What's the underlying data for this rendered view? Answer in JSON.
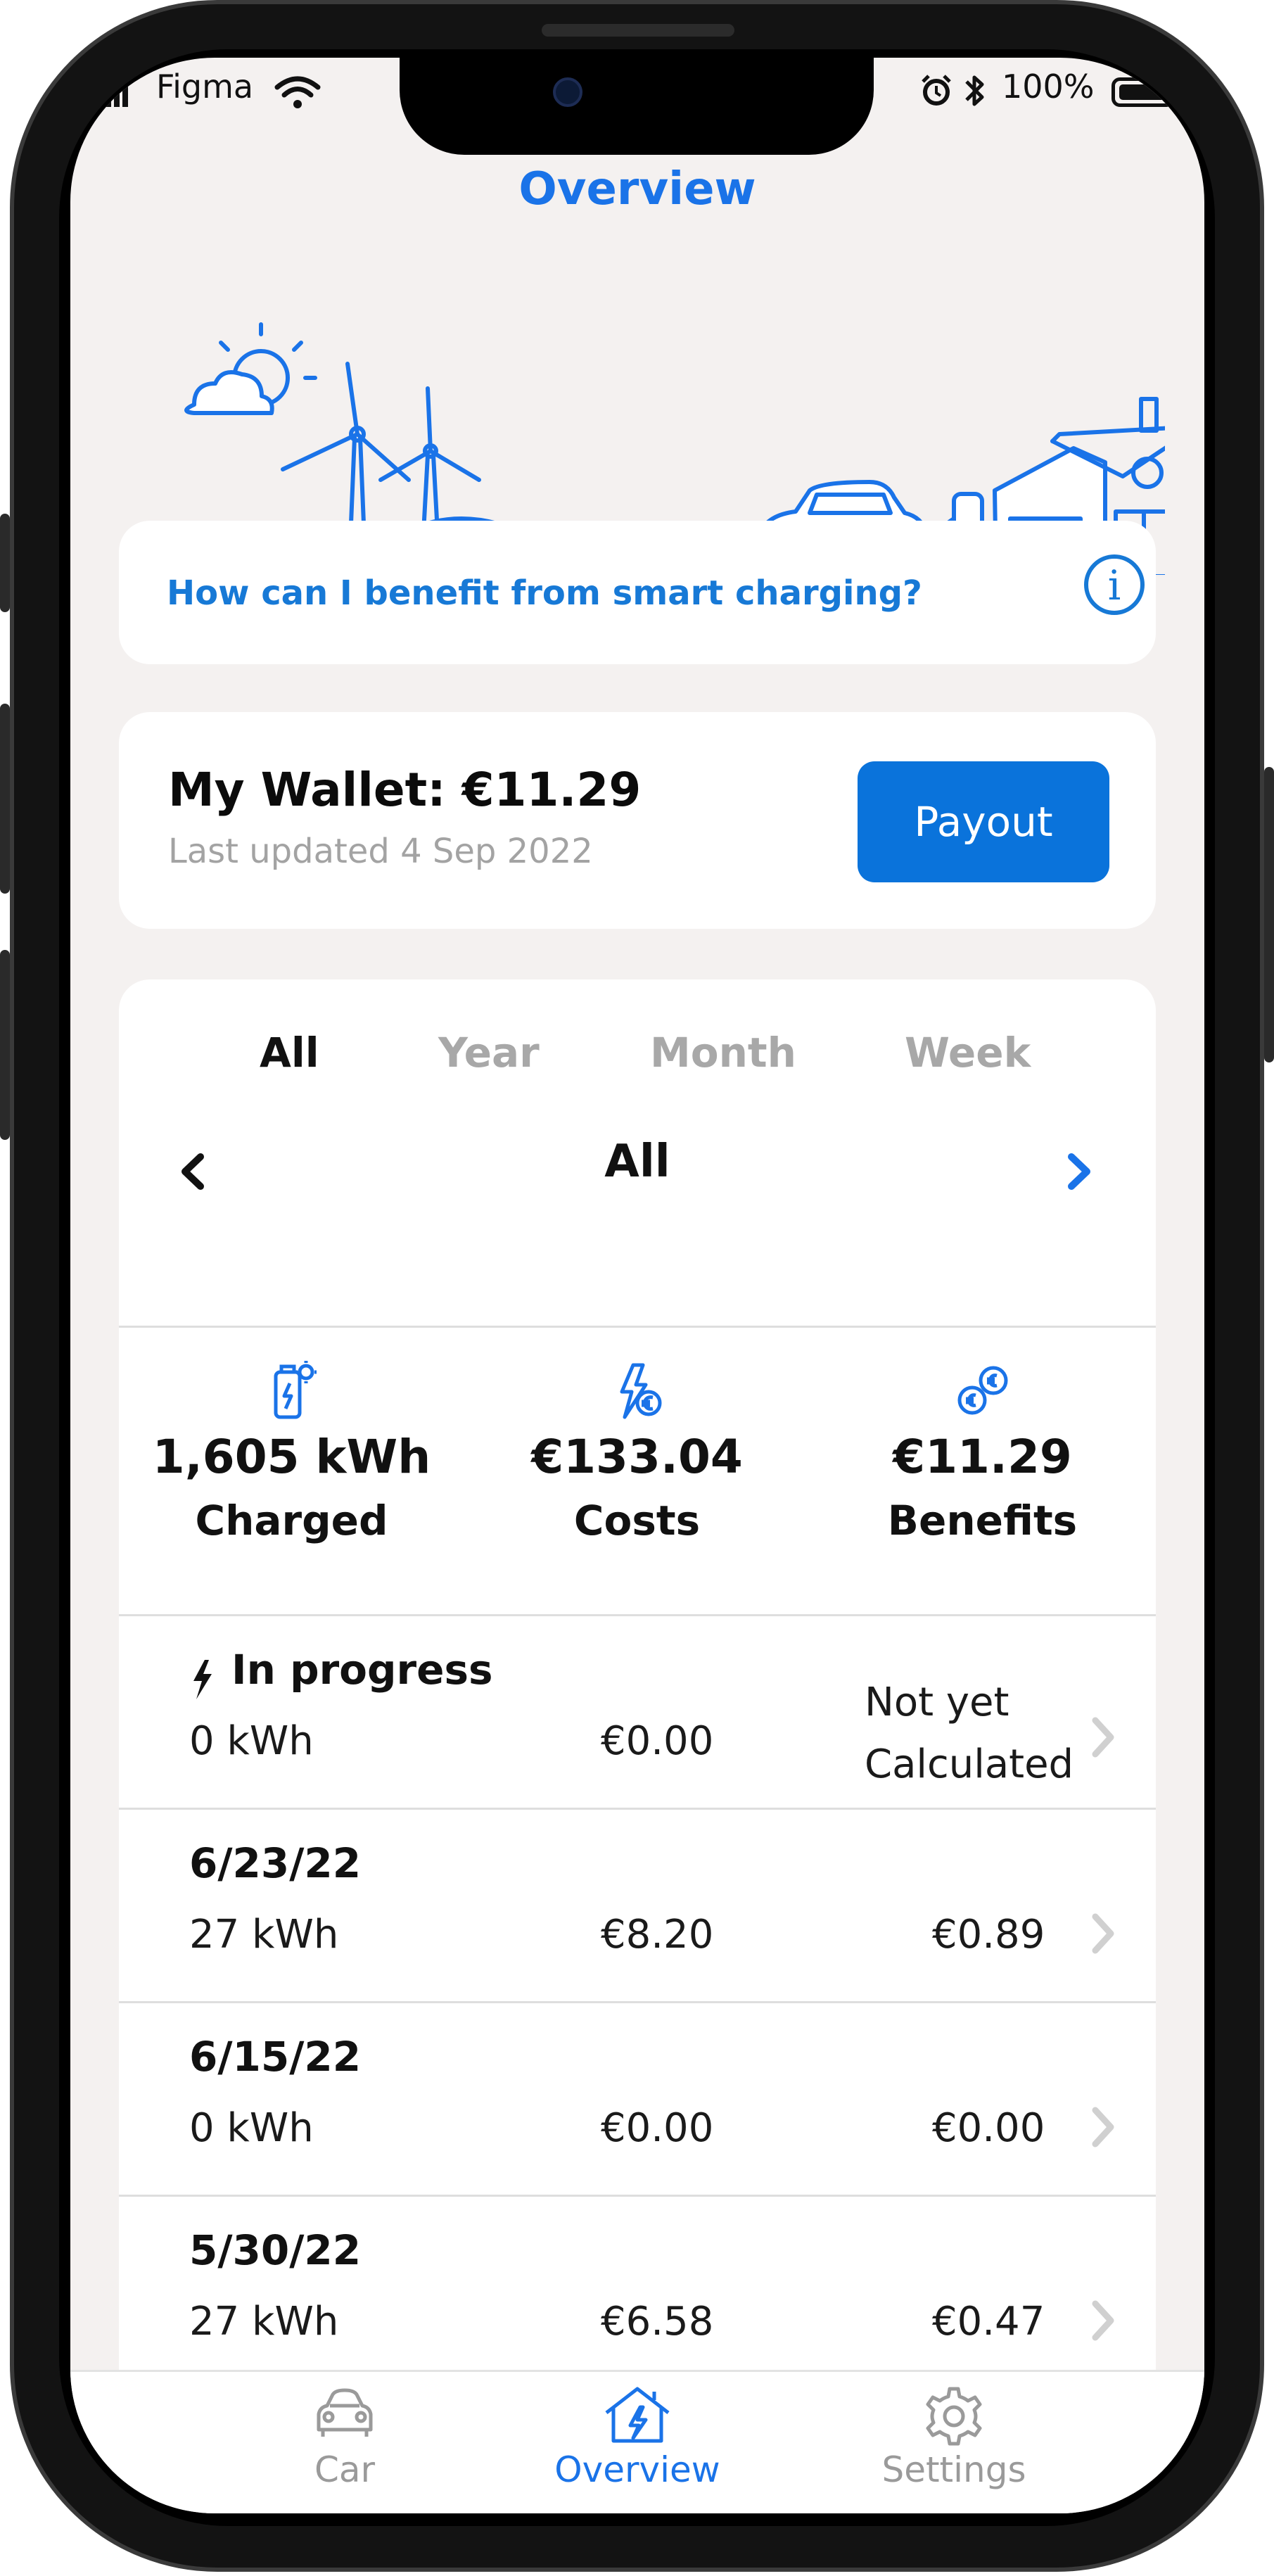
{
  "status_bar": {
    "carrier": "Figma",
    "battery": "100%"
  },
  "header": {
    "title": "Overview"
  },
  "info_banner": {
    "text": "How can I benefit from smart charging?"
  },
  "wallet": {
    "title": "My Wallet: €11.29",
    "updated": "Last updated 4 Sep 2022",
    "payout_label": "Payout"
  },
  "period_tabs": [
    {
      "label": "All",
      "active": true
    },
    {
      "label": "Year",
      "active": false
    },
    {
      "label": "Month",
      "active": false
    },
    {
      "label": "Week",
      "active": false
    }
  ],
  "period_nav": {
    "label": "All"
  },
  "summary": [
    {
      "value": "1,605 kWh",
      "label": "Charged",
      "icon": "battery-charging-icon"
    },
    {
      "value": "€133.04",
      "label": "Costs",
      "icon": "cost-lightning-icon"
    },
    {
      "value": "€11.29",
      "label": "Benefits",
      "icon": "coins-icon"
    }
  ],
  "sessions": [
    {
      "date": "In progress",
      "energy": "0 kWh",
      "cost": "€0.00",
      "benefit_line1": "Not yet",
      "benefit_line2": "Calculated",
      "in_progress": true
    },
    {
      "date": "6/23/22",
      "energy": "27 kWh",
      "cost": "€8.20",
      "benefit": "€0.89"
    },
    {
      "date": "6/15/22",
      "energy": "0 kWh",
      "cost": "€0.00",
      "benefit": "€0.00"
    },
    {
      "date": "5/30/22",
      "energy": "27 kWh",
      "cost": "€6.58",
      "benefit": "€0.47"
    }
  ],
  "tabbar": [
    {
      "label": "Car",
      "icon": "car-icon",
      "active": false
    },
    {
      "label": "Overview",
      "icon": "house-charging-icon",
      "active": true
    },
    {
      "label": "Settings",
      "icon": "gear-icon",
      "active": false
    }
  ],
  "colors": {
    "accent": "#1a73e8",
    "button": "#0a73db",
    "background": "#f4f1f0"
  }
}
